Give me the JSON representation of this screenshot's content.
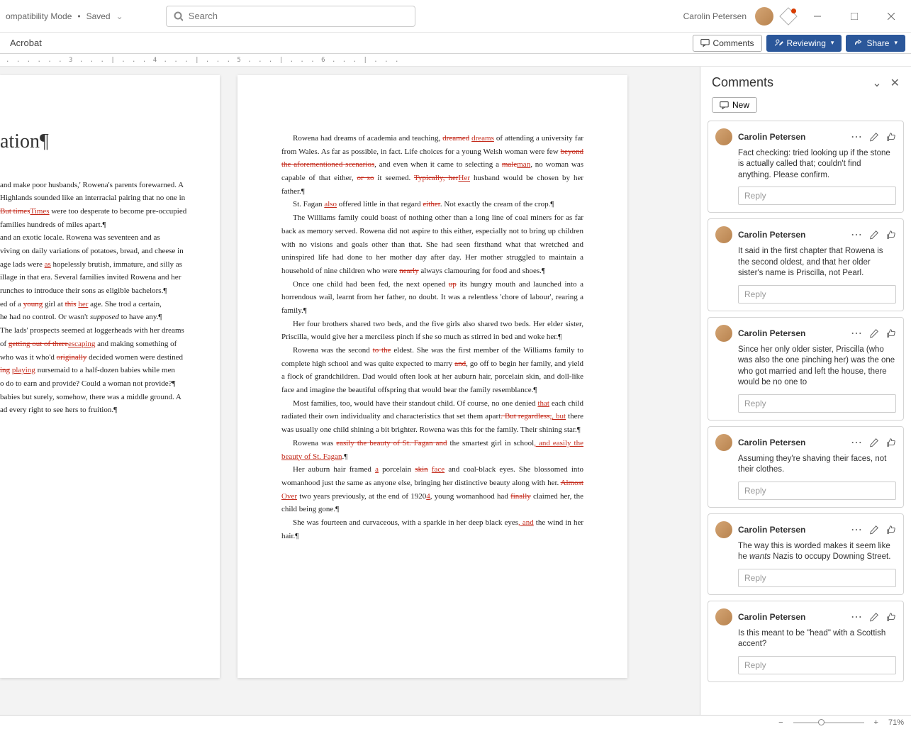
{
  "title_bar": {
    "mode": "ompatibility Mode",
    "saved": "Saved",
    "search_placeholder": "Search",
    "user": "Carolin Petersen"
  },
  "ribbon": {
    "tabs": [
      "",
      "Acrobat"
    ],
    "comments_btn": "Comments",
    "reviewing_btn": "Reviewing",
    "share_btn": "Share"
  },
  "ruler": ". . . . . . 3 . . . | . . . 4 . . . | . . . 5 . . . | . . . 6 . . . | . . .",
  "doc_left": {
    "heading": "ation¶",
    "body": [
      "and make poor husbands,' Rowena's parents forewarned. A",
      "Highlands sounded like an interracial pairing that no one in",
      " <del>But times</del><ins>Times</ins> were too desperate to become pre-occupied",
      " families hundreds of miles apart.¶",
      " and an exotic locale. Rowena was seventeen and as",
      "viving on daily variations of potatoes, bread, and cheese in",
      " age lads were <ins>as</ins> hopelessly brutish, immature, and silly as",
      "illage in that era. Several families invited Rowena and her",
      "runches to introduce their sons as eligible bachelors.¶",
      "ed of a <del>young</del> girl at <del>this</del> <ins>her</ins> age. She trod a certain,",
      "he had no control. Or wasn't <i>supposed</i> to have any.¶",
      "The lads' prospects seemed at loggerheads with her dreams",
      " of <del>getting out of there</del><ins>escaping</ins> and making something of",
      " who was it who'd <del>originally</del> decided women were destined",
      "<del>ing</del> <ins>playing</ins> nursemaid to a half-dozen babies while men",
      "o do to earn and provide? Could a woman not provide?¶",
      " babies but surely, somehow, there was a middle ground. A",
      "ad every right to see hers to fruition.¶"
    ]
  },
  "doc_right": {
    "paras": [
      "Rowena had dreams of academia and teaching, <del>dreamed</del> <ins>dreams</ins> of attending a university far from Wales. As far as possible, in fact. Life choices for a young Welsh woman were few <del>beyond the aforementioned scenarios</del>, and even when it came to selecting a <del>male</del><ins>man</ins>, no woman was capable of that either, <del>or so</del> it seemed. <del>Typically, her</del><ins>Her</ins> husband would be chosen by her father.¶",
      "St. Fagan <ins>also</ins> offered little in that regard <del>either</del>. Not exactly the cream of the crop.¶",
      "The Williams family could boast of nothing other than a long line of coal miners for as far back as memory served. Rowena did not aspire to this either, especially not to bring up children with no visions and goals other than that. She had seen firsthand what that wretched and uninspired life had done to her mother day after day. Her mother struggled to maintain a household of nine children who were <del>nearly</del> always clamouring for food and shoes.¶",
      "Once one child had been fed, the next opened <del>up</del> its hungry mouth and launched into a horrendous wail, learnt from her father, no doubt. It was a relentless 'chore of labour', rearing a family.¶",
      "Her four brothers shared two beds, and the five girls also shared two beds. Her elder sister, Priscilla, would give her a merciless pinch if she so much as stirred in bed and woke her.¶",
      "Rowena was the second <del>to the</del> eldest. She was the first member of the Williams family to complete high school and was quite expected to marry <del>and</del>, go off to begin her family, and yield a flock of grandchildren. Dad would often look at her auburn hair, porcelain skin, and doll-like face and imagine the beautiful offspring that would bear the family resemblance.¶",
      "Most families, too, would have their standout child. Of course, no one denied <ins>that</ins> each child radiated their own individuality and characteristics that set them apart<del>. But regardless,</del><ins>, but</ins> there was usually one child shining a bit brighter. Rowena was this for the family. Their shining star.¶",
      "Rowena was <del>easily the beauty of St. Fagan and</del> the smartest girl in school<ins>, and easily the beauty of St. Fagan</ins>.¶",
      "Her auburn hair framed <ins>a</ins> porcelain <del>skin</del> <ins>face</ins> and coal-black eyes. She blossomed into womanhood just the same as anyone else, bringing her distinctive beauty along with her. <del>Almost</del> <ins>Over</ins> two years previously, at the end of 1920<ins>4</ins>, young womanhood had <del>finally</del> claimed her, the child being gone.¶",
      "She was fourteen and curvaceous, with a sparkle in her deep black eyes<ins>, and</ins> the wind in her hair.¶"
    ]
  },
  "comments_pane": {
    "title": "Comments",
    "new_btn": "New",
    "reply_placeholder": "Reply",
    "items": [
      {
        "author": "Carolin Petersen",
        "text": "Fact checking: tried looking up if the stone is actually called that; couldn't find anything. Please confirm."
      },
      {
        "author": "Carolin Petersen",
        "text": "It said in the first chapter that Rowena is the second oldest, and that her older sister's name is Priscilla, not Pearl."
      },
      {
        "author": "Carolin Petersen",
        "text": "Since her only older sister, Priscilla (who was also the one pinching her) was the one who got married and left the house, there would be no one to"
      },
      {
        "author": "Carolin Petersen",
        "text": "Assuming they're shaving their faces, not their clothes."
      },
      {
        "author": "Carolin Petersen",
        "text": "The way this is worded makes it seem like he <i>wants</i> Nazis to occupy Downing Street."
      },
      {
        "author": "Carolin Petersen",
        "text": "Is this meant to be \"head\" with a Scottish accent?"
      }
    ]
  },
  "status": {
    "zoom": "71%"
  }
}
